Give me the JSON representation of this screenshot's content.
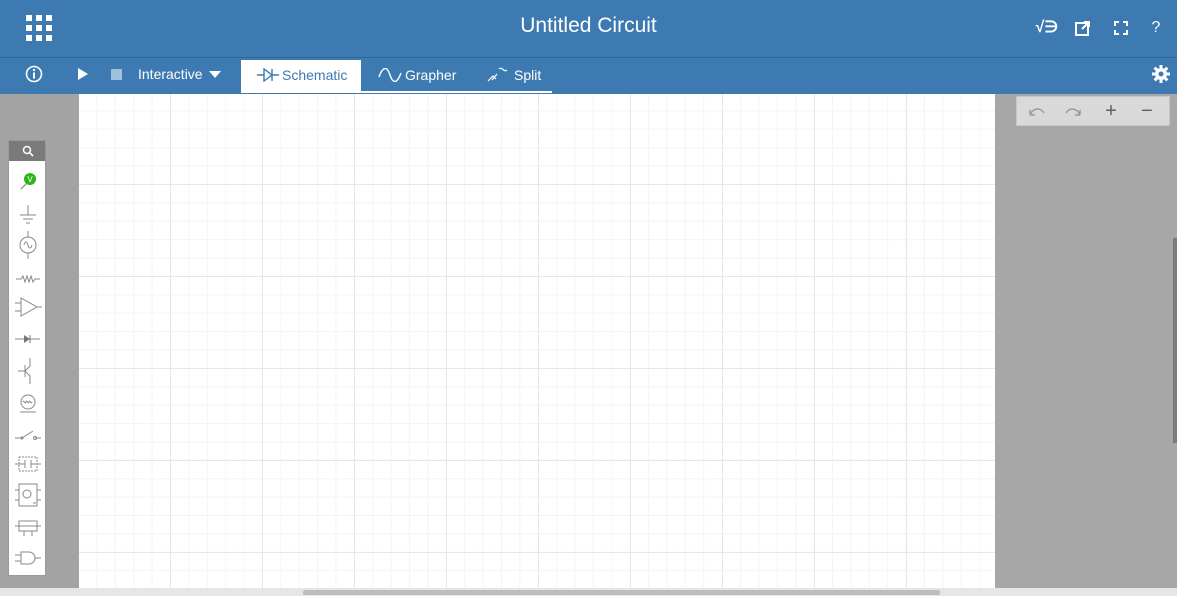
{
  "header": {
    "title": "Untitled Circuit",
    "apps_icon": "grid-apps-icon",
    "right_icons": [
      "sqrt-math-icon",
      "external-link-icon",
      "fullscreen-icon",
      "help-icon"
    ],
    "help_text": "?",
    "sqrt_text": "√∋"
  },
  "toolbar": {
    "info_icon": "info-icon",
    "play_icon": "play-icon",
    "stop_icon": "stop-icon",
    "mode_label": "Interactive",
    "tabs": [
      {
        "label": "Schematic",
        "icon": "diode-schematic-icon",
        "active": true
      },
      {
        "label": "Grapher",
        "icon": "sine-wave-icon",
        "active": false
      },
      {
        "label": "Split",
        "icon": "split-icon",
        "active": false
      }
    ],
    "settings_icon": "gear-icon"
  },
  "palette": {
    "search_icon": "search-icon",
    "items": [
      "voltmeter-probe-icon",
      "ground-icon",
      "ac-source-icon",
      "resistor-icon",
      "opamp-icon",
      "diode-icon",
      "transistor-icon",
      "lamp-icon",
      "switch-icon",
      "logic-block-icon",
      "ic-chip-icon",
      "relay-icon",
      "and-gate-icon"
    ],
    "probe_label": "V"
  },
  "zoom_controls": {
    "undo_icon": "undo-icon",
    "redo_icon": "redo-icon",
    "zoom_in": "+",
    "zoom_out": "−"
  },
  "colors": {
    "brand_blue": "#3d7ab1",
    "probe_green": "#2fb51c",
    "canvas_grid": "#e6e6e6"
  }
}
